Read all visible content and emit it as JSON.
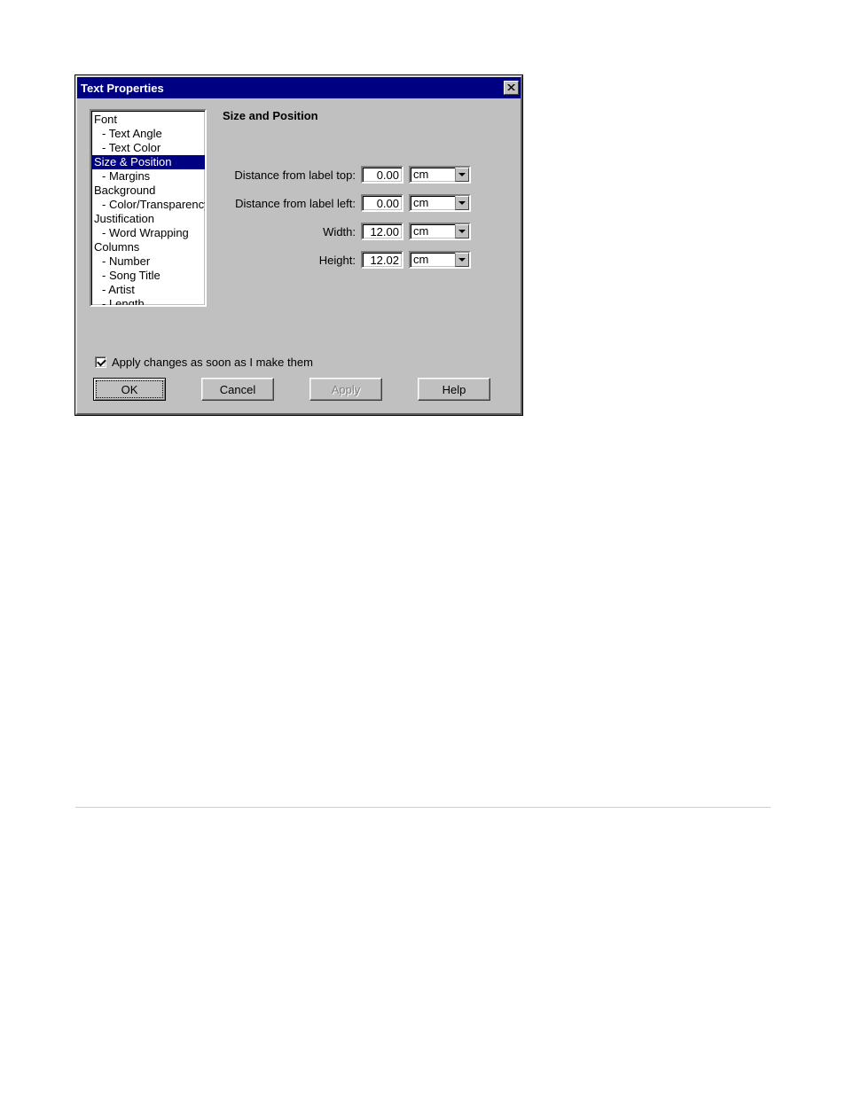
{
  "dialog": {
    "title": "Text Properties"
  },
  "tree": {
    "items": [
      {
        "label": "Font",
        "level": 1
      },
      {
        "label": "- Text Angle",
        "level": 2
      },
      {
        "label": "- Text Color",
        "level": 2
      },
      {
        "label": "Size & Position",
        "level": 1,
        "selected": true
      },
      {
        "label": "- Margins",
        "level": 2
      },
      {
        "label": "Background",
        "level": 1
      },
      {
        "label": "- Color/Transparency",
        "level": 2
      },
      {
        "label": "Justification",
        "level": 1
      },
      {
        "label": "- Word Wrapping",
        "level": 2
      },
      {
        "label": "Columns",
        "level": 1
      },
      {
        "label": "- Number",
        "level": 2
      },
      {
        "label": "- Song Title",
        "level": 2
      },
      {
        "label": "- Artist",
        "level": 2
      },
      {
        "label": "- Length",
        "level": 2
      }
    ]
  },
  "panel": {
    "heading": "Size and Position",
    "fields": [
      {
        "label": "Distance from label top:",
        "value": "0.00",
        "unit": "cm"
      },
      {
        "label": "Distance from label left:",
        "value": "0.00",
        "unit": "cm"
      },
      {
        "label": "Width:",
        "value": "12.00",
        "unit": "cm"
      },
      {
        "label": "Height:",
        "value": "12.02",
        "unit": "cm"
      }
    ]
  },
  "checkbox": {
    "label": "Apply changes as soon as I make them",
    "checked": true
  },
  "buttons": {
    "ok": "OK",
    "cancel": "Cancel",
    "apply": "Apply",
    "help": "Help"
  }
}
